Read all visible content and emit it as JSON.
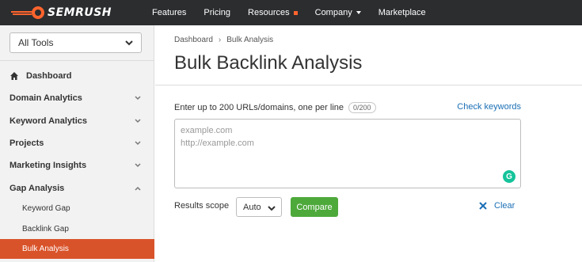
{
  "colors": {
    "topbar": "#2b2d2f",
    "accent": "#d9532a",
    "compare": "#4ea93b",
    "link": "#1a6fb5",
    "resources_badge": "#ff642d"
  },
  "brand": {
    "name": "SEMRUSH"
  },
  "topnav": {
    "items": [
      "Features",
      "Pricing",
      "Resources",
      "Company",
      "Marketplace"
    ]
  },
  "sidebar": {
    "tool_select": "All Tools",
    "dashboard": "Dashboard",
    "sections": [
      "Domain Analytics",
      "Keyword Analytics",
      "Projects",
      "Marketing Insights",
      "Gap Analysis"
    ],
    "gap_items": [
      "Keyword Gap",
      "Backlink Gap",
      "Bulk Analysis"
    ]
  },
  "breadcrumb": {
    "root": "Dashboard",
    "separator": "›",
    "current": "Bulk Analysis"
  },
  "page": {
    "title": "Bulk Backlink Analysis",
    "hint": "Enter up to 200 URLs/domains, one per line",
    "counter": "0/200",
    "check_keywords": "Check keywords",
    "urls_placeholder": "example.com\nhttp://example.com",
    "results_scope_label": "Results scope",
    "scope_value": "Auto",
    "compare": "Compare",
    "clear": "Clear"
  }
}
